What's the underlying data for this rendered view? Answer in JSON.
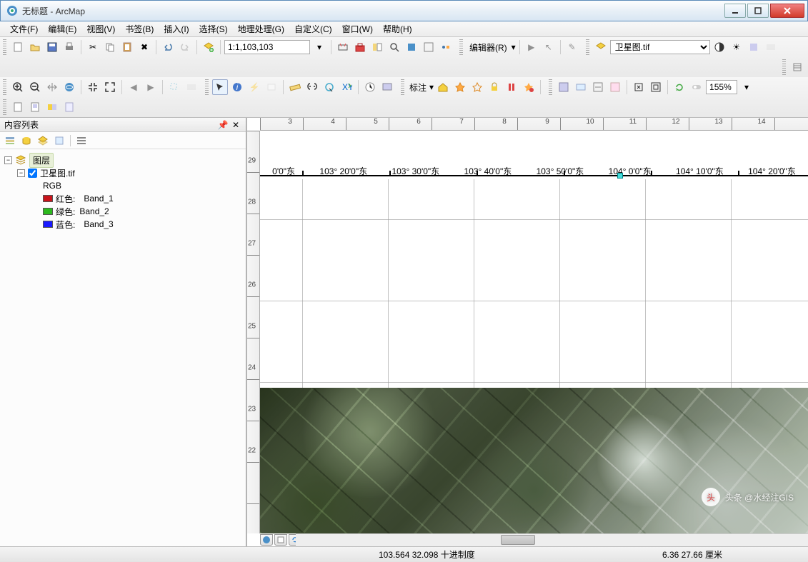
{
  "window": {
    "title": "无标题 - ArcMap"
  },
  "menus": [
    "文件(F)",
    "编辑(E)",
    "视图(V)",
    "书签(B)",
    "插入(I)",
    "选择(S)",
    "地理处理(G)",
    "自定义(C)",
    "窗口(W)",
    "帮助(H)"
  ],
  "toolbar1": {
    "scale_value": "1:1,103,103",
    "editor_label": "编辑器(R)",
    "layer_dropdown": "卫星图.tif"
  },
  "toolbar2": {
    "label_dropdown": "标注",
    "zoom_pct": "155%"
  },
  "toc": {
    "title": "内容列表",
    "root": "图层",
    "layer_name": "卫星图.tif",
    "composite": "RGB",
    "bands": [
      {
        "color": "#c8141b",
        "label": "红色:",
        "band": "Band_1"
      },
      {
        "color": "#2cb91e",
        "label": "绿色:",
        "band": "Band_2"
      },
      {
        "color": "#1a1aff",
        "label": "蓝色:",
        "band": "Band_3"
      }
    ]
  },
  "ruler_h": [
    "3",
    "4",
    "5",
    "6",
    "7",
    "8",
    "9",
    "10",
    "11",
    "12",
    "13",
    "14"
  ],
  "ruler_v": [
    "29",
    "28",
    "27",
    "26",
    "25",
    "24",
    "23",
    "22"
  ],
  "coord_labels": [
    "0'0\"东",
    "103° 20'0\"东",
    "103° 30'0\"东",
    "103° 40'0\"东",
    "103° 50'0\"东",
    "104° 0'0\"东",
    "104° 10'0\"东",
    "104° 20'0\"东"
  ],
  "status": {
    "coords": "103.564  32.098 十进制度",
    "size": "6.36  27.66 厘米"
  },
  "watermark": "头条 @水经注GIS"
}
